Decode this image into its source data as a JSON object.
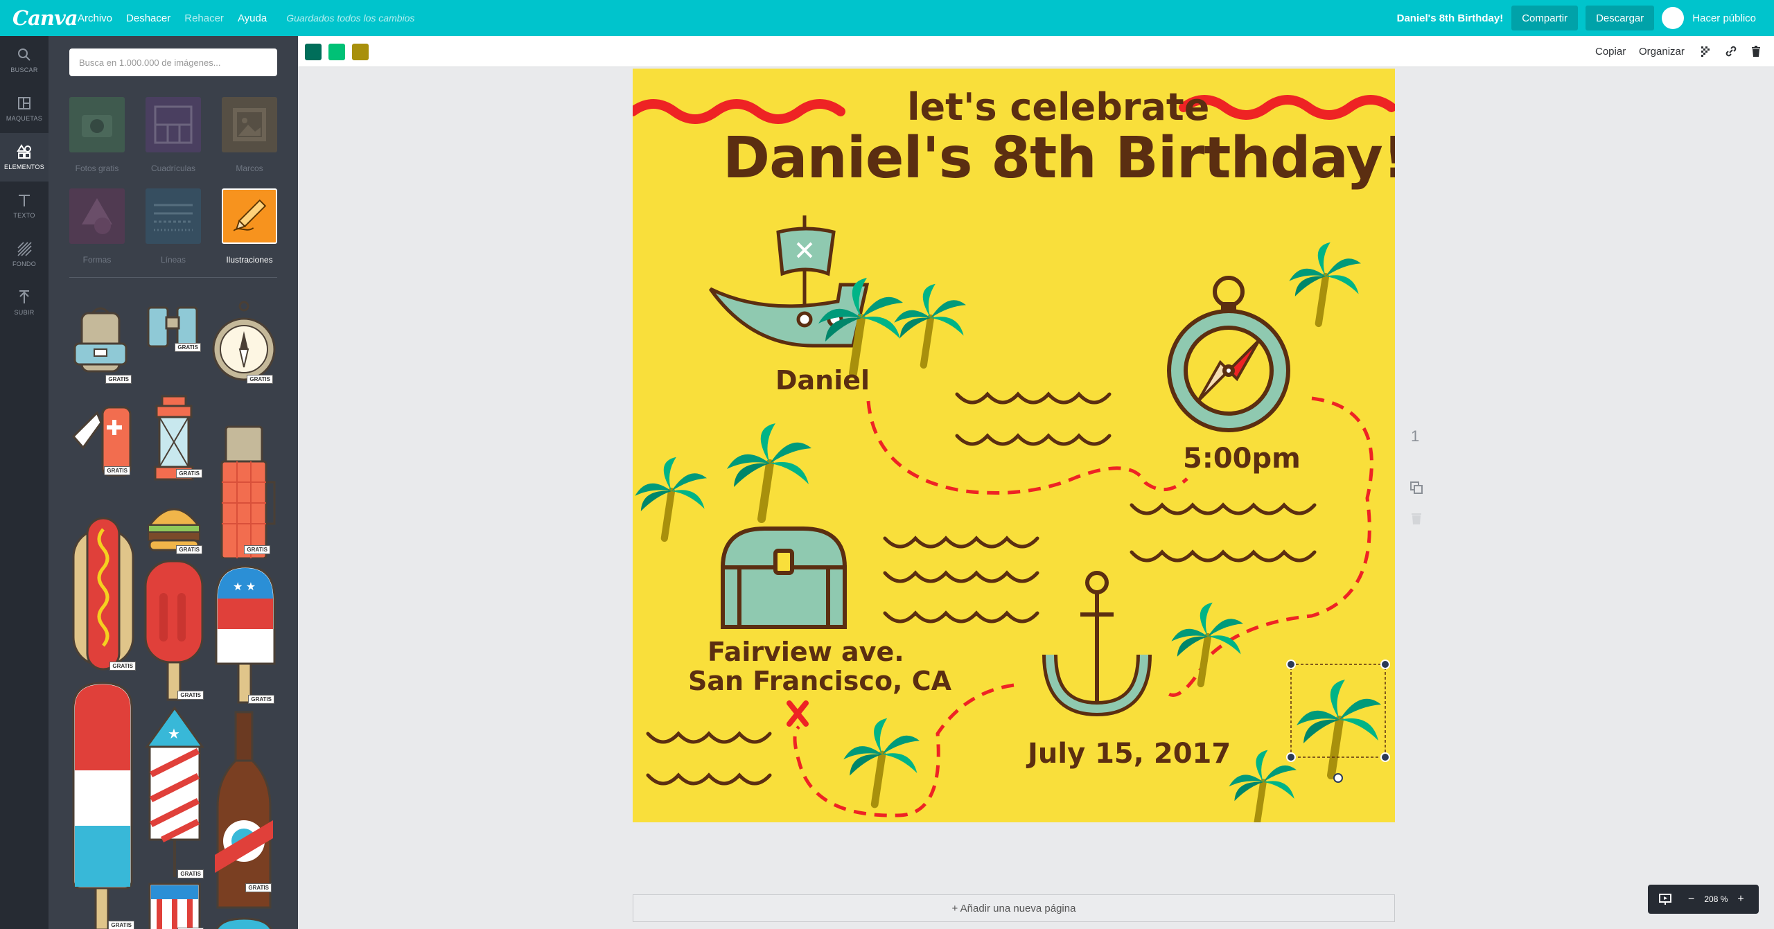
{
  "topbar": {
    "logo": "Canva",
    "menu": {
      "file": "Archivo",
      "undo": "Deshacer",
      "redo": "Rehacer",
      "help": "Ayuda"
    },
    "saved_status": "Guardados todos los cambios",
    "doc_title": "Daniel's 8th Birthday!",
    "share": "Compartir",
    "download": "Descargar",
    "make_public": "Hacer público"
  },
  "rail": [
    {
      "label": "BUSCAR",
      "icon": "search-icon"
    },
    {
      "label": "MAQUETAS",
      "icon": "layouts-icon"
    },
    {
      "label": "ELEMENTOS",
      "icon": "elements-icon",
      "active": true
    },
    {
      "label": "TEXTO",
      "icon": "text-icon"
    },
    {
      "label": "FONDO",
      "icon": "background-icon"
    },
    {
      "label": "SUBIR",
      "icon": "upload-icon"
    }
  ],
  "panel": {
    "search_placeholder": "Busca en 1.000.000 de imágenes...",
    "categories": [
      {
        "label": "Fotos gratis",
        "icon": "camera-icon",
        "color": "#4b8a57"
      },
      {
        "label": "Cuadrículas",
        "icon": "grid-icon",
        "color": "#6a3f8a"
      },
      {
        "label": "Marcos",
        "icon": "frame-icon",
        "color": "#8a6d3b"
      },
      {
        "label": "Formas",
        "icon": "shapes-icon",
        "color": "#7a2f5f"
      },
      {
        "label": "Líneas",
        "icon": "lines-icon",
        "color": "#2f6a8a"
      },
      {
        "label": "Ilustraciones",
        "icon": "pencil-icon",
        "color": "#f7931e"
      }
    ],
    "badge": "GRATIS"
  },
  "toolbar": {
    "colors": [
      "#006e5a",
      "#00c176",
      "#a8900c"
    ],
    "copy": "Copiar",
    "arrange": "Organizar"
  },
  "design": {
    "subtitle": "let's celebrate",
    "title": "Daniel's 8th Birthday!",
    "name": "Daniel",
    "time": "5:00pm",
    "address_line1": "Fairview ave.",
    "address_line2": "San Francisco, CA",
    "date": "July 15, 2017",
    "colors": {
      "background": "#f9df3b",
      "text": "#5b2e11",
      "red": "#ee2324",
      "teal": "#8fc9b0",
      "palm": "#009a7a"
    }
  },
  "page": {
    "number": "1",
    "add_page": "+ Añadir una nueva página"
  },
  "zoom": {
    "level": "208 %",
    "minus": "−",
    "plus": "+"
  }
}
